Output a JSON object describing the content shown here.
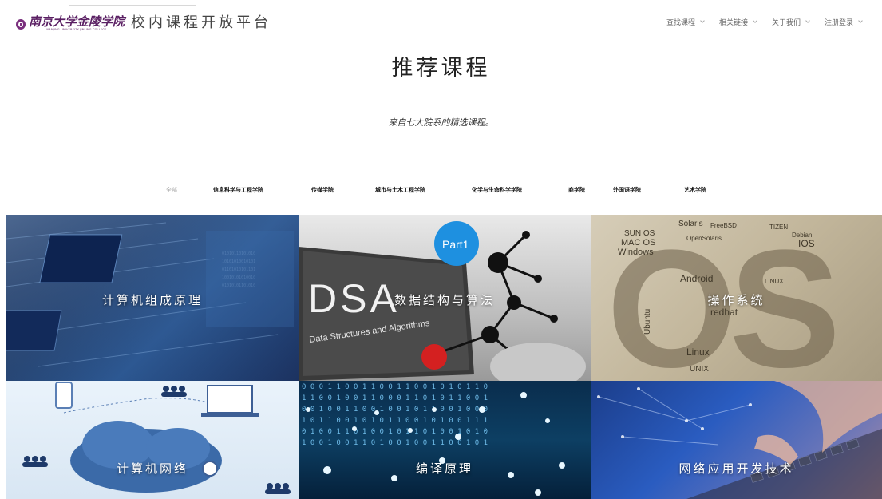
{
  "header": {
    "logo_text": "南京大学金陵学院",
    "logo_subtext": "NANJING UNIVERSITY JINLING COLLEGE",
    "site_title": "校内课程开放平台",
    "nav": [
      {
        "label": "查找课程"
      },
      {
        "label": "相关链接"
      },
      {
        "label": "关于我们"
      },
      {
        "label": "注册登录"
      }
    ]
  },
  "section": {
    "title": "推荐课程",
    "subtitle": "来自七大院系的精选课程。"
  },
  "filters": [
    {
      "label": "全部",
      "active": true
    },
    {
      "label": "信息科学与工程学院",
      "active": false
    },
    {
      "label": "传媒学院",
      "active": false
    },
    {
      "label": "城市与土木工程学院",
      "active": false
    },
    {
      "label": "化学与生命科学学院",
      "active": false
    },
    {
      "label": "商学院",
      "active": false
    },
    {
      "label": "外国语学院",
      "active": false
    },
    {
      "label": "艺术学院",
      "active": false
    }
  ],
  "courses": [
    {
      "title": "计算机组成原理",
      "image_text": []
    },
    {
      "title": "数据结构与算法",
      "image_text": [
        "Part1",
        "DSA",
        "Data Structures and Algorithms"
      ]
    },
    {
      "title": "操作系统",
      "image_text": [
        "Solaris",
        "SUN OS",
        "MAC OS",
        "Windows",
        "Android",
        "IOS",
        "LINUX",
        "Ubuntu",
        "redhat",
        "Linux",
        "UNIX",
        "Debian",
        "TIZEN",
        "FreeBSD",
        "OpenSolaris",
        "OS"
      ]
    },
    {
      "title": "计算机网络",
      "image_text": []
    },
    {
      "title": "编译原理",
      "image_text": []
    },
    {
      "title": "网络应用开发技术",
      "image_text": []
    }
  ],
  "colors": {
    "logo": "#5a1f63",
    "filter_active": "#aaaaaa",
    "dsa_badge": "#1e90e0",
    "dsa_red_node": "#d42020"
  }
}
